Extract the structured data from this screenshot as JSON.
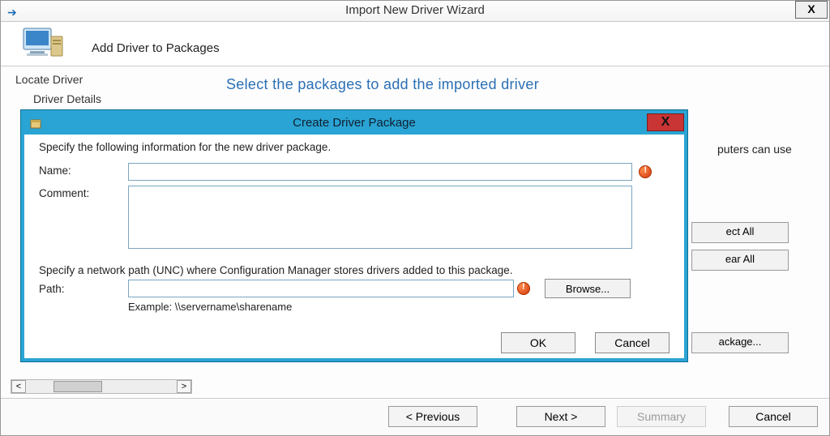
{
  "wizard": {
    "title": "Import New Driver Wizard",
    "close_glyph": "X",
    "header_text": "Add Driver to Packages",
    "steps": {
      "locate": "Locate Driver",
      "details": "Driver Details"
    },
    "page_heading": "Select the packages to add the imported driver",
    "more_text_fragment": "puters can use",
    "buttons": {
      "select_all_fragment": "ect All",
      "clear_all_fragment": "ear All",
      "new_package_fragment": "ackage..."
    },
    "nav": {
      "previous": "< Previous",
      "next": "Next >",
      "summary": "Summary",
      "cancel": "Cancel"
    }
  },
  "modal": {
    "title": "Create Driver Package",
    "close_glyph": "X",
    "instruction1": "Specify the following information for the new driver package.",
    "name_label": "Name:",
    "name_value": "",
    "comment_label": "Comment:",
    "comment_value": "",
    "instruction2": "Specify a network path (UNC) where Configuration Manager stores drivers added to this package.",
    "path_label": "Path:",
    "path_value": "",
    "browse_label": "Browse...",
    "example_hint": "Example: \\\\servername\\sharename",
    "ok_label": "OK",
    "cancel_label": "Cancel"
  },
  "scroll": {
    "left_glyph": "<",
    "right_glyph": ">"
  }
}
